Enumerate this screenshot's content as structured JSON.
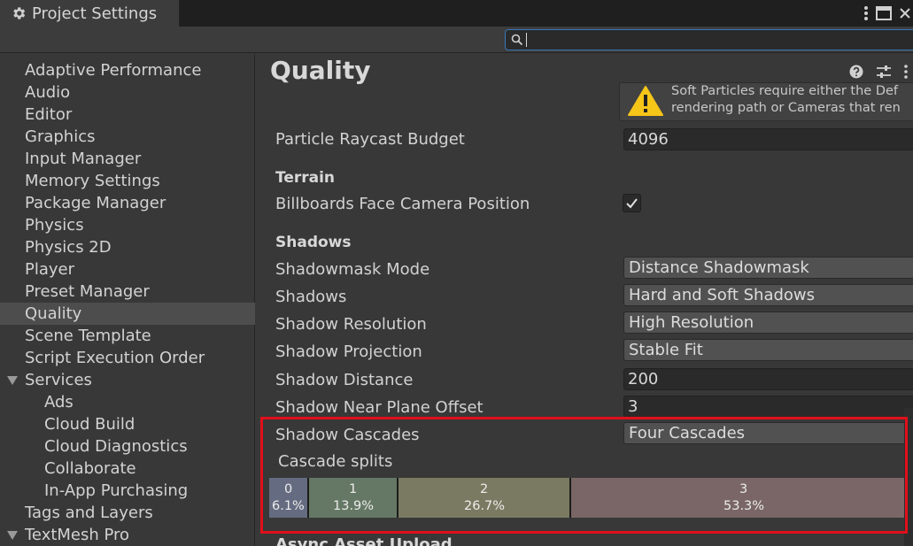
{
  "window": {
    "title": "Project Settings"
  },
  "sidebar": {
    "items": [
      {
        "label": "Adaptive Performance"
      },
      {
        "label": "Audio"
      },
      {
        "label": "Editor"
      },
      {
        "label": "Graphics"
      },
      {
        "label": "Input Manager"
      },
      {
        "label": "Memory Settings"
      },
      {
        "label": "Package Manager"
      },
      {
        "label": "Physics"
      },
      {
        "label": "Physics 2D"
      },
      {
        "label": "Player"
      },
      {
        "label": "Preset Manager"
      },
      {
        "label": "Quality",
        "selected": true
      },
      {
        "label": "Scene Template"
      },
      {
        "label": "Script Execution Order"
      },
      {
        "label": "Services",
        "expanded": true
      },
      {
        "label": "Ads",
        "child": true
      },
      {
        "label": "Cloud Build",
        "child": true
      },
      {
        "label": "Cloud Diagnostics",
        "child": true
      },
      {
        "label": "Collaborate",
        "child": true
      },
      {
        "label": "In-App Purchasing",
        "child": true
      },
      {
        "label": "Tags and Layers"
      },
      {
        "label": "TextMesh Pro",
        "expanded": true
      }
    ]
  },
  "main": {
    "title": "Quality",
    "warning": {
      "line1": "Soft Particles require either the Def",
      "line2": "rendering path or Cameras that ren"
    },
    "particle_raycast_budget": {
      "label": "Particle Raycast Budget",
      "value": "4096"
    },
    "terrain": {
      "header": "Terrain",
      "billboards": {
        "label": "Billboards Face Camera Position",
        "checked": true
      }
    },
    "shadows": {
      "header": "Shadows",
      "shadowmask_mode": {
        "label": "Shadowmask Mode",
        "value": "Distance Shadowmask"
      },
      "shadows": {
        "label": "Shadows",
        "value": "Hard and Soft Shadows"
      },
      "shadow_resolution": {
        "label": "Shadow Resolution",
        "value": "High Resolution"
      },
      "shadow_projection": {
        "label": "Shadow Projection",
        "value": "Stable Fit"
      },
      "shadow_distance": {
        "label": "Shadow Distance",
        "value": "200"
      },
      "shadow_near_plane_offset": {
        "label": "Shadow Near Plane Offset",
        "value": "3"
      },
      "shadow_cascades": {
        "label": "Shadow Cascades",
        "value": "Four Cascades"
      },
      "cascade_splits_label": "Cascade splits",
      "cascade_splits": [
        {
          "index": "0",
          "percent": "6.1%",
          "fraction": 0.061,
          "color": "#656b80"
        },
        {
          "index": "1",
          "percent": "13.9%",
          "fraction": 0.139,
          "color": "#657865"
        },
        {
          "index": "2",
          "percent": "26.7%",
          "fraction": 0.267,
          "color": "#7a7a62"
        },
        {
          "index": "3",
          "percent": "53.3%",
          "fraction": 0.533,
          "color": "#7a6666"
        }
      ]
    },
    "next_section": "Async Asset Upload"
  }
}
